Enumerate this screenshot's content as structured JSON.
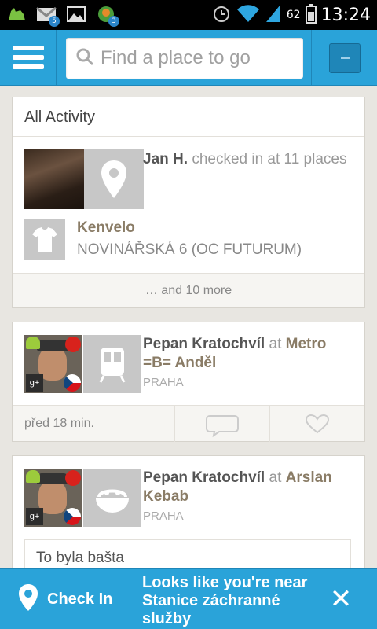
{
  "status_bar": {
    "time": "13:24",
    "battery": "62",
    "gmail_badge": "5",
    "app_badge": "3"
  },
  "topbar": {
    "search_placeholder": "Find a place to go"
  },
  "all_activity": {
    "title": "All Activity",
    "user": "Jan H.",
    "action": "checked in at 11 places",
    "venue_name": "Kenvelo",
    "venue_address": "NOVINÁŘSKÁ 6 (OC FUTURUM)",
    "more": "… and 10 more"
  },
  "checkin1": {
    "user": "Pepan Kratochvíl",
    "at": "at",
    "place": "Metro =B= Anděl",
    "city": "PRAHA",
    "time": "před 18 min."
  },
  "checkin2": {
    "user": "Pepan Kratochvíl",
    "at": "at",
    "place": "Arslan Kebab",
    "city": "PRAHA",
    "comment": "To byla bašta"
  },
  "bottom_bar": {
    "checkin_label": "Check In",
    "nearby_text": "Looks like you're near Stanice záchranné služby",
    "close_symbol": "✕"
  }
}
